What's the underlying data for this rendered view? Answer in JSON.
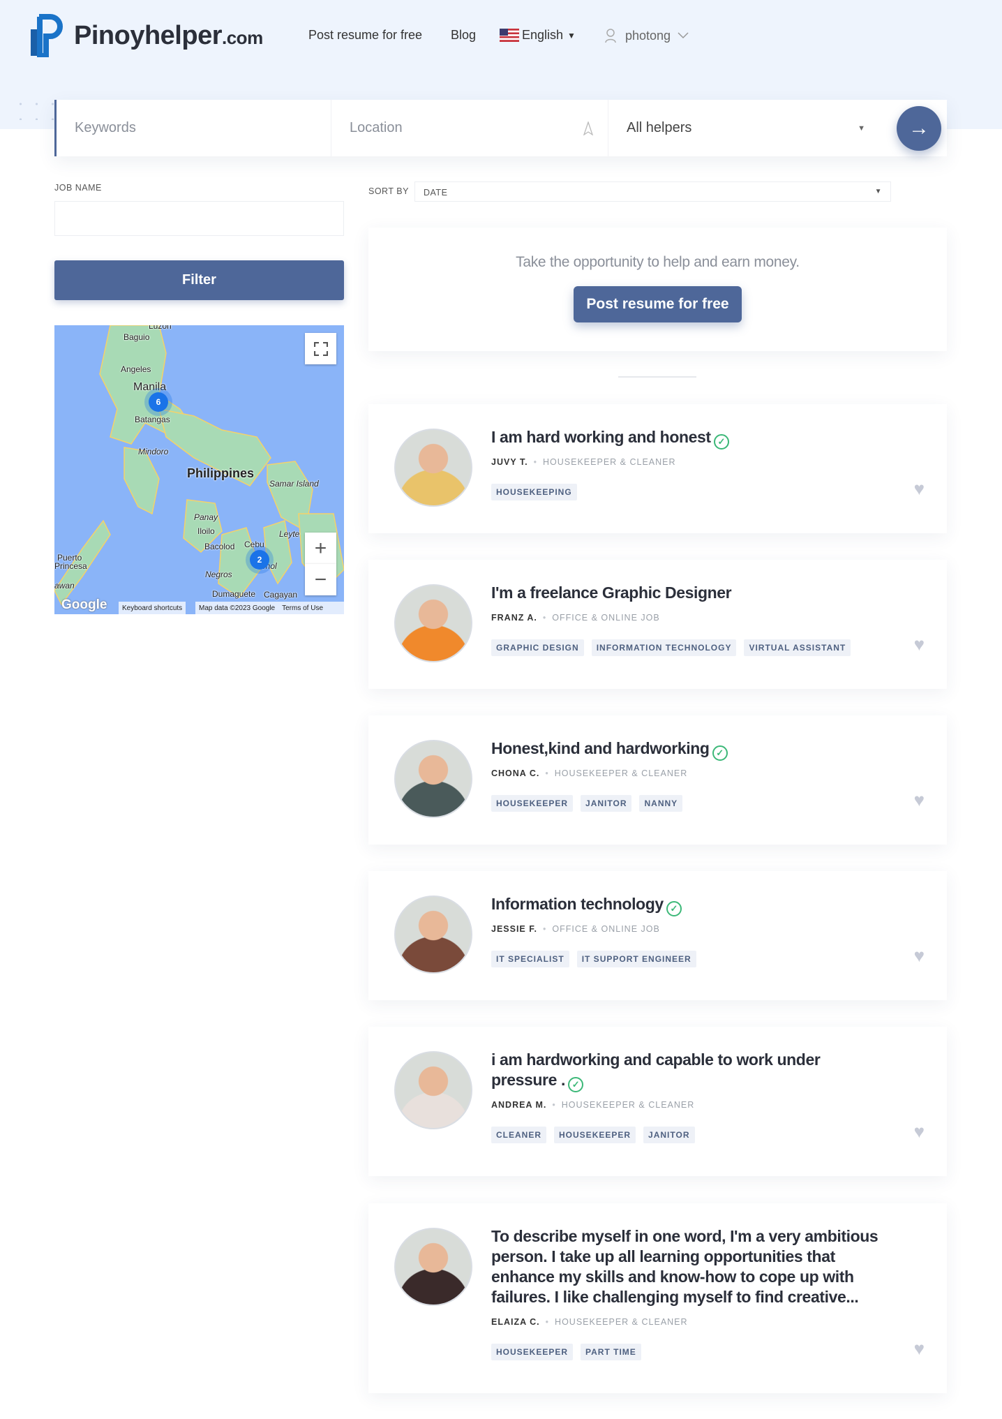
{
  "header": {
    "logo_text": "Pinoyhelper",
    "logo_suffix": ".com",
    "nav": {
      "post_resume": "Post resume for free",
      "blog": "Blog",
      "language": "English",
      "user": "photong"
    }
  },
  "search": {
    "keywords_placeholder": "Keywords",
    "location_placeholder": "Location",
    "category": "All helpers"
  },
  "filters": {
    "job_name_label": "JOB NAME",
    "job_name_value": "",
    "filter_button": "Filter",
    "sort_by_label": "SORT BY",
    "sort_value": "DATE"
  },
  "map": {
    "labels": {
      "luzon": "Luzon",
      "baguio": "Baguio",
      "angeles": "Angeles",
      "manila": "Manila",
      "batangas": "Batangas",
      "mindoro": "Mindoro",
      "philippines": "Philippines",
      "samar": "Samar Island",
      "panay": "Panay",
      "iloilo": "Iloilo",
      "bacolod": "Bacolod",
      "cebu": "Cebu",
      "leyte": "Leyte",
      "bohol": "Bohol",
      "negros": "Negros",
      "dumaguete": "Dumaguete",
      "cagayan": "Cagayan",
      "puerto": "Puerto",
      "princesa": "Princesa",
      "palawan": "awan"
    },
    "clusters": {
      "manila": "6",
      "cebu": "2"
    },
    "google": "Google",
    "shortcuts": "Keyboard shortcuts",
    "map_data": "Map data ©2023 Google",
    "terms": "Terms of Use"
  },
  "promo": {
    "text": "Take the opportunity to help and earn money.",
    "button": "Post resume for free"
  },
  "colors": {
    "accent": "#4e6799",
    "verified": "#3cb878",
    "header_bg": "#eef4fd"
  },
  "cards": [
    {
      "title": "I am hard working and honest",
      "verified": true,
      "name": "JUVY T.",
      "category": "HOUSEKEEPER & CLEANER",
      "tags": [
        "HOUSEKEEPING"
      ]
    },
    {
      "title": "I'm a freelance Graphic Designer",
      "verified": false,
      "name": "FRANZ A.",
      "category": "OFFICE & ONLINE JOB",
      "tags": [
        "GRAPHIC DESIGN",
        "INFORMATION TECHNOLOGY",
        "VIRTUAL ASSISTANT"
      ]
    },
    {
      "title": "Honest,kind and hardworking",
      "verified": true,
      "name": "CHONA C.",
      "category": "HOUSEKEEPER & CLEANER",
      "tags": [
        "HOUSEKEEPER",
        "JANITOR",
        "NANNY"
      ]
    },
    {
      "title": "Information technology",
      "verified": true,
      "name": "JESSIE F.",
      "category": "OFFICE & ONLINE JOB",
      "tags": [
        "IT SPECIALIST",
        "IT SUPPORT ENGINEER"
      ]
    },
    {
      "title": "i am hardworking and capable to work under pressure .",
      "verified": true,
      "name": "ANDREA M.",
      "category": "HOUSEKEEPER & CLEANER",
      "tags": [
        "CLEANER",
        "HOUSEKEEPER",
        "JANITOR"
      ]
    },
    {
      "title": "To describe myself in one word, I'm a very ambitious person. I take up all learning opportunities that enhance my skills and know-how to cope up with failures. I like challenging myself to find creative...",
      "verified": false,
      "name": "ELAIZA C.",
      "category": "HOUSEKEEPER & CLEANER",
      "tags": [
        "HOUSEKEEPER",
        "PART TIME"
      ]
    }
  ]
}
